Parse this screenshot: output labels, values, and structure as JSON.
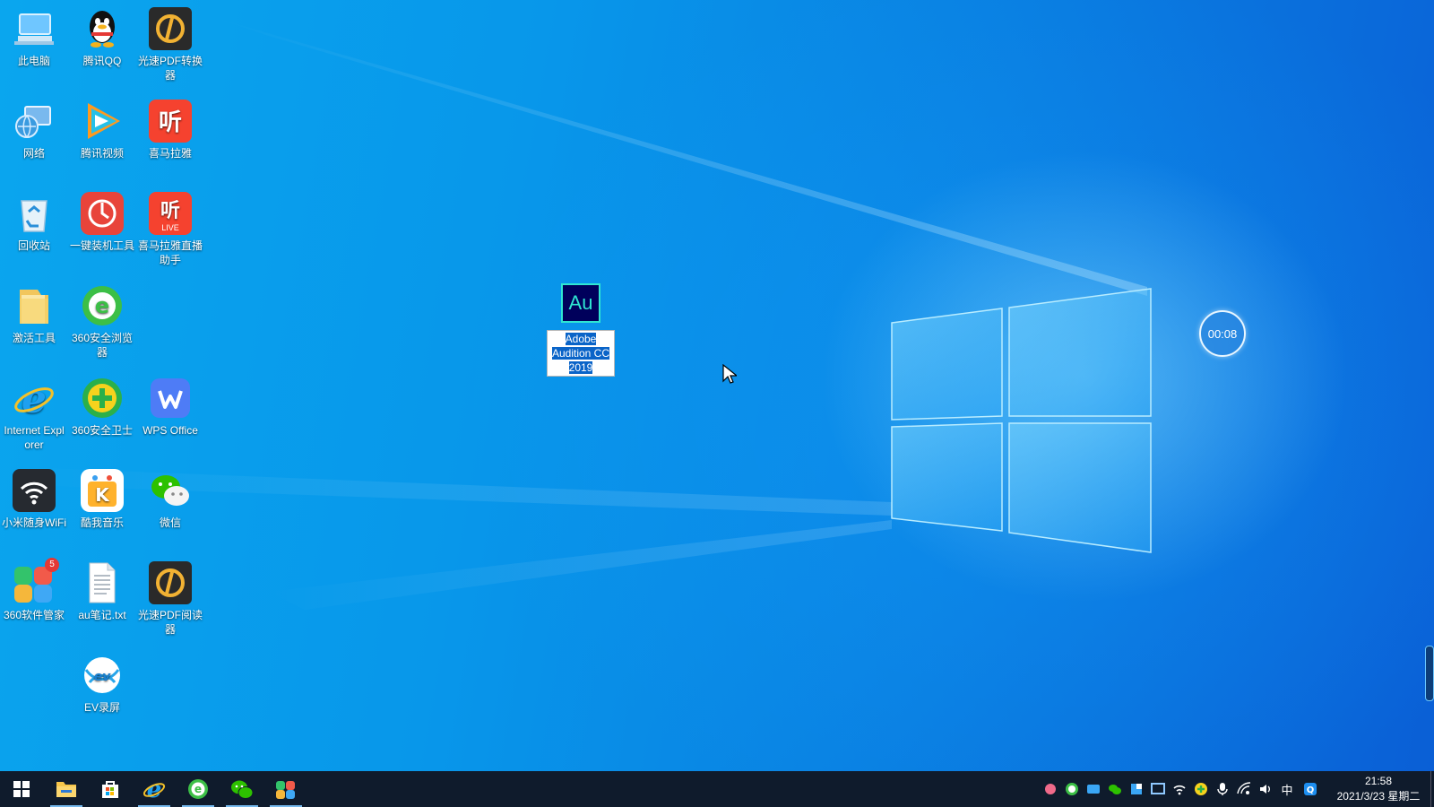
{
  "desktop": {
    "icons": [
      {
        "label": "此电脑",
        "icon": "this-pc-icon"
      },
      {
        "label": "腾讯QQ",
        "icon": "qq-penguin-icon"
      },
      {
        "label": "光速PDF转换器",
        "icon": "pdf-converter-icon"
      },
      {
        "label": "网络",
        "icon": "network-icon"
      },
      {
        "label": "腾讯视频",
        "icon": "tencent-video-icon"
      },
      {
        "label": "喜马拉雅",
        "icon": "ximalaya-icon"
      },
      {
        "label": "回收站",
        "icon": "recycle-bin-icon"
      },
      {
        "label": "一键装机工具",
        "icon": "install-tool-icon"
      },
      {
        "label": "喜马拉雅直播助手",
        "icon": "ximalaya-live-icon"
      },
      {
        "label": "激活工具",
        "icon": "folder-icon"
      },
      {
        "label": "360安全浏览器",
        "icon": "browser-360-icon"
      },
      {
        "label": "Internet Explorer",
        "icon": "internet-explorer-icon"
      },
      {
        "label": "360安全卫士",
        "icon": "security-360-icon"
      },
      {
        "label": "WPS Office",
        "icon": "wps-office-icon"
      },
      {
        "label": "小米随身WiFi",
        "icon": "wifi-icon"
      },
      {
        "label": "酷我音乐",
        "icon": "kuwo-music-icon"
      },
      {
        "label": "微信",
        "icon": "wechat-icon"
      },
      {
        "label": "360软件管家",
        "icon": "software-manager-360-icon"
      },
      {
        "label": "au笔记.txt",
        "icon": "text-file-icon"
      },
      {
        "label": "光速PDF阅读器",
        "icon": "pdf-reader-icon"
      },
      {
        "label": "EV录屏",
        "icon": "ev-recorder-icon"
      }
    ],
    "badge_360_manager": "5",
    "live_tag": "LIVE",
    "selected_icon": {
      "label_lines": [
        "Adobe",
        "Audition CC",
        "2019"
      ],
      "glyph": "Au",
      "icon": "adobe-audition-icon"
    },
    "timer_overlay": "00:08"
  },
  "taskbar": {
    "pinned": [
      "start-icon",
      "file-explorer-icon",
      "store-icon",
      "internet-explorer-icon",
      "browser-360-icon",
      "wechat-icon",
      "software-manager-360-icon"
    ],
    "tray": {
      "ime": "中",
      "time": "21:58",
      "date": "2021/3/23 星期二"
    }
  },
  "colors": {
    "desktop_bg": "#0a8fe8",
    "taskbar_bg": "#0f1b2c",
    "selection": "#0a64c8",
    "audition_bg": "#00005b",
    "audition_fg": "#9999ff"
  }
}
